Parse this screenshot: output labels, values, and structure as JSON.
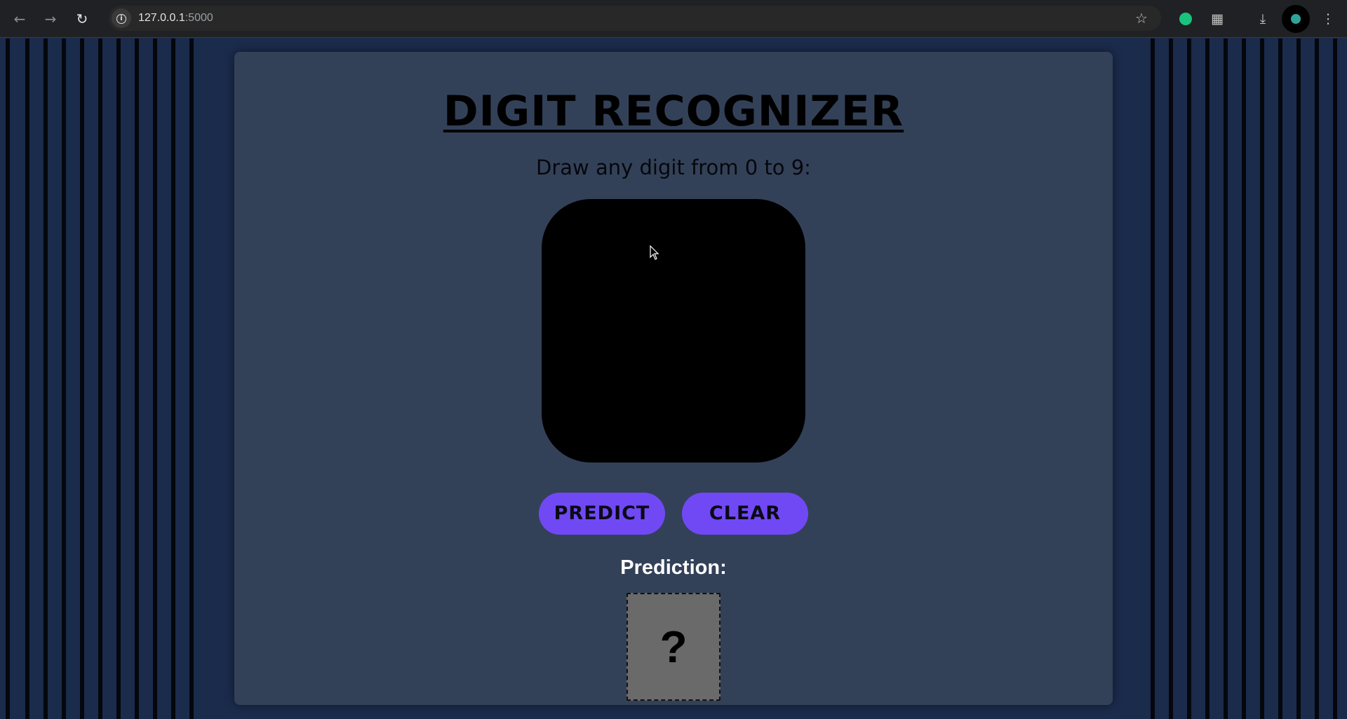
{
  "browser": {
    "url_host": "127.0.0.1",
    "url_port": ":5000",
    "back_icon": "arrow-left-icon",
    "forward_icon": "arrow-right-icon",
    "reload_icon": "reload-icon",
    "star_icon": "star-icon",
    "extensions_icon": "puzzle-icon",
    "downloads_icon": "download-icon",
    "menu_icon": "kebab-menu-icon"
  },
  "app": {
    "title": "DIGIT RECOGNIZER",
    "instruction": "Draw any digit from 0 to 9:",
    "predict_label": "PREDICT",
    "clear_label": "CLEAR",
    "prediction_label": "Prediction:",
    "prediction_value": "?"
  },
  "colors": {
    "page_background": "#1b2b4c",
    "card_background": "#334158",
    "canvas_background": "#000000",
    "button_accent": "#7049f5",
    "prediction_box": "#6a6a6a"
  }
}
